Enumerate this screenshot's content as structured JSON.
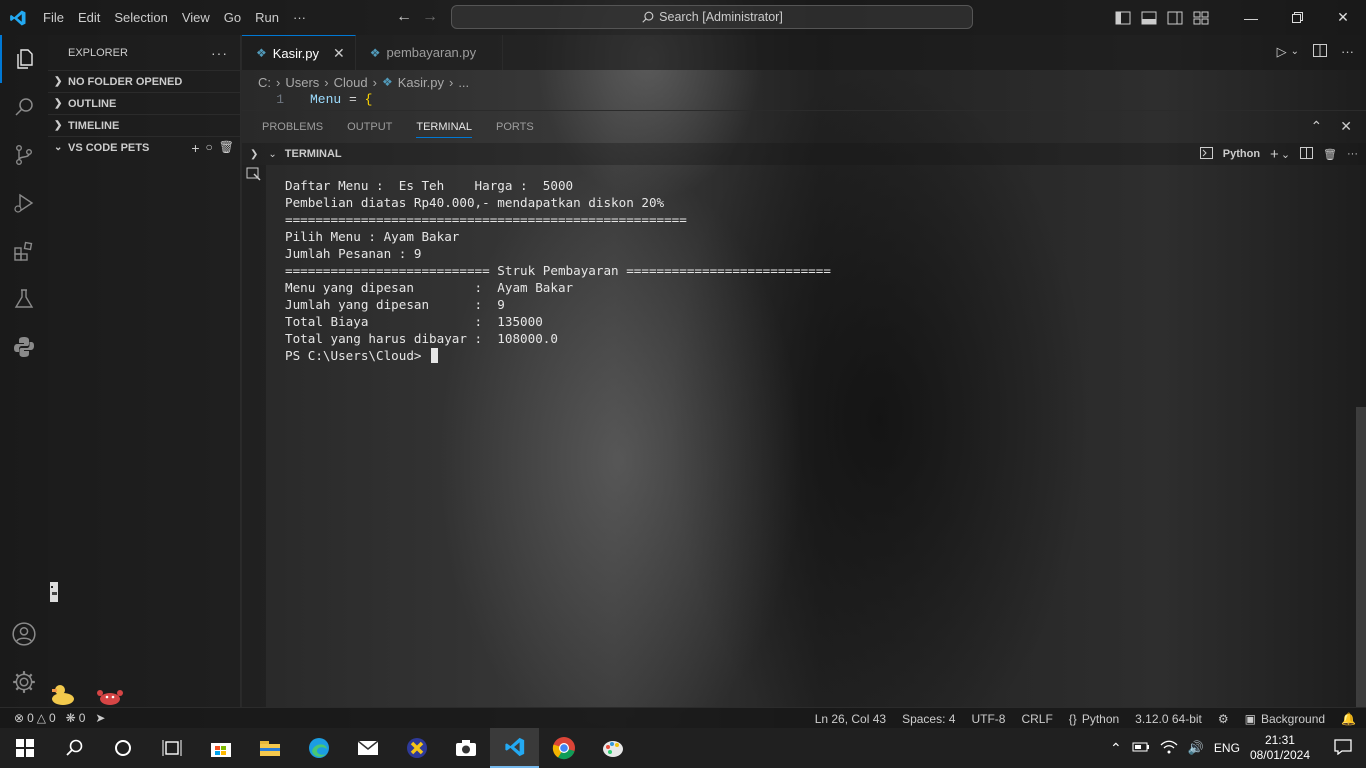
{
  "menu": {
    "items": [
      "File",
      "Edit",
      "Selection",
      "View",
      "Go",
      "Run",
      "···"
    ]
  },
  "search": {
    "label": "Search [Administrator]"
  },
  "sidebar": {
    "title": "EXPLORER",
    "sections": [
      {
        "label": "NO FOLDER OPENED"
      },
      {
        "label": "OUTLINE"
      },
      {
        "label": "TIMELINE"
      },
      {
        "label": "VS CODE PETS"
      }
    ]
  },
  "tabs": [
    {
      "label": "Kasir.py",
      "active": true
    },
    {
      "label": "pembayaran.py",
      "active": false
    }
  ],
  "breadcrumb": [
    "C:",
    "Users",
    "Cloud",
    "Kasir.py",
    "..."
  ],
  "editor": {
    "line_number": "1",
    "code_var": "Menu",
    "code_op": " = ",
    "code_brace": "{"
  },
  "panel": {
    "tabs": [
      "PROBLEMS",
      "OUTPUT",
      "TERMINAL",
      "PORTS"
    ],
    "terminal_header": "TERMINAL",
    "shell_label": "Python"
  },
  "terminal": {
    "lines": [
      "Daftar Menu :  Es Teh    Harga :  5000",
      "Pembelian diatas Rp40.000,- mendapatkan diskon 20%",
      "=====================================================",
      "Pilih Menu : Ayam Bakar",
      "Jumlah Pesanan : 9",
      "=========================== Struk Pembayaran ===========================",
      "Menu yang dipesan        :  Ayam Bakar",
      "Jumlah yang dipesan      :  9",
      "Total Biaya              :  135000",
      "Total yang harus dibayar :  108000.0"
    ],
    "prompt": "PS C:\\Users\\Cloud> "
  },
  "statusbar": {
    "errors": "0",
    "warnings": "0",
    "ports": "0",
    "position": "Ln 26, Col 43",
    "spaces": "Spaces: 4",
    "encoding": "UTF-8",
    "eol": "CRLF",
    "language": "Python",
    "interpreter": "3.12.0 64-bit",
    "background": "Background"
  },
  "taskbar": {
    "lang": "ENG",
    "time": "21:31",
    "date": "08/01/2024"
  },
  "colors": {
    "accent": "#0078d4",
    "python_icon": "#519aba"
  }
}
